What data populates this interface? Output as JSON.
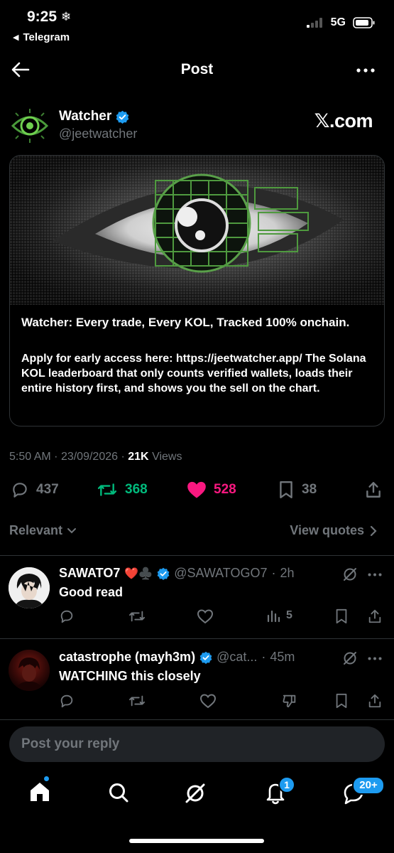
{
  "status_bar": {
    "time": "9:25",
    "back_app": "Telegram",
    "network": "5G"
  },
  "header": {
    "title": "Post"
  },
  "author": {
    "name": "Watcher",
    "handle": "@jeetwatcher",
    "source": "𝕏.com"
  },
  "card": {
    "title": "Watcher: Every trade, Every KOL, Tracked 100% onchain.",
    "description": "Apply for early access here: https://jeetwatcher.app/ The Solana KOL leaderboard that only counts verified wallets, loads their entire history first, and shows you the sell on the chart."
  },
  "meta": {
    "time": "5:50 AM",
    "date": "23/09/2026",
    "views_count": "21K",
    "views_label": "Views"
  },
  "stats": {
    "replies": "437",
    "reposts": "368",
    "likes": "528",
    "bookmarks": "38"
  },
  "colors": {
    "repost_active": "#00ba7c",
    "like_active": "#f91880",
    "verified": "#1d9bf0",
    "muted": "#71767b"
  },
  "sort": {
    "label": "Relevant",
    "view_quotes": "View quotes"
  },
  "replies": [
    {
      "name": "SAWATO7",
      "emoji": "❤️♣️",
      "handle": "@SAWATOGO7",
      "time": "2h",
      "text": "Good read",
      "views": "5"
    },
    {
      "name": "catastrophe (mayh3m)",
      "handle": "@cat...",
      "time": "45m",
      "text": "WATCHING this closely"
    }
  ],
  "reply_input": {
    "placeholder": "Post your reply"
  },
  "tabbar": {
    "notifications_badge": "1",
    "messages_badge": "20+"
  }
}
